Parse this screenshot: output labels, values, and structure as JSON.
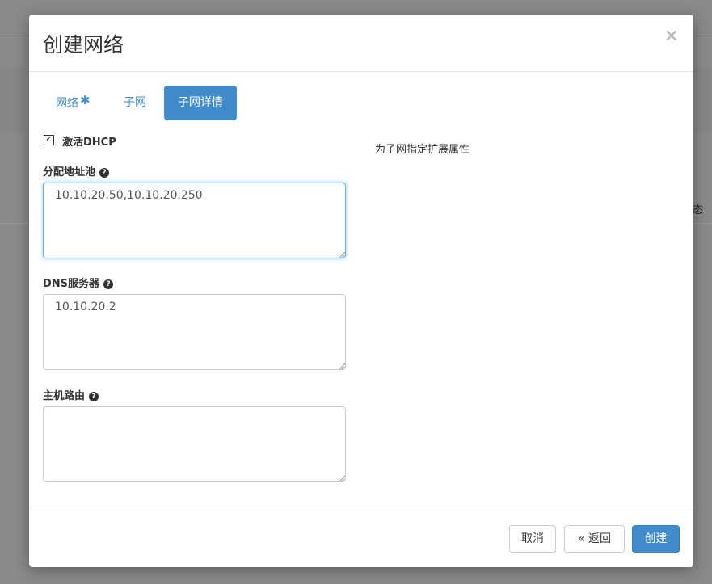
{
  "background": {
    "status_fragment": "态"
  },
  "modal": {
    "title": "创建网络",
    "close_glyph": "×"
  },
  "tabs": [
    {
      "label": "网络",
      "required_mark": "✱",
      "active": false
    },
    {
      "label": "子网",
      "active": false
    },
    {
      "label": "子网详情",
      "active": true
    }
  ],
  "form": {
    "enable_dhcp": {
      "label": "激活DHCP",
      "checked": true
    },
    "allocation_pools": {
      "label": "分配地址池",
      "value": "10.10.20.50,10.10.20.250"
    },
    "dns_servers": {
      "label": "DNS服务器",
      "value": "10.10.20.2"
    },
    "host_routes": {
      "label": "主机路由",
      "value": ""
    },
    "help_icon_glyph": "?"
  },
  "help_text": "为子网指定扩展属性",
  "footer": {
    "cancel_label": "取消",
    "back_label": "« 返回",
    "create_label": "创建"
  },
  "colors": {
    "primary": "#428bca",
    "overlay": "#8a8a8a"
  }
}
